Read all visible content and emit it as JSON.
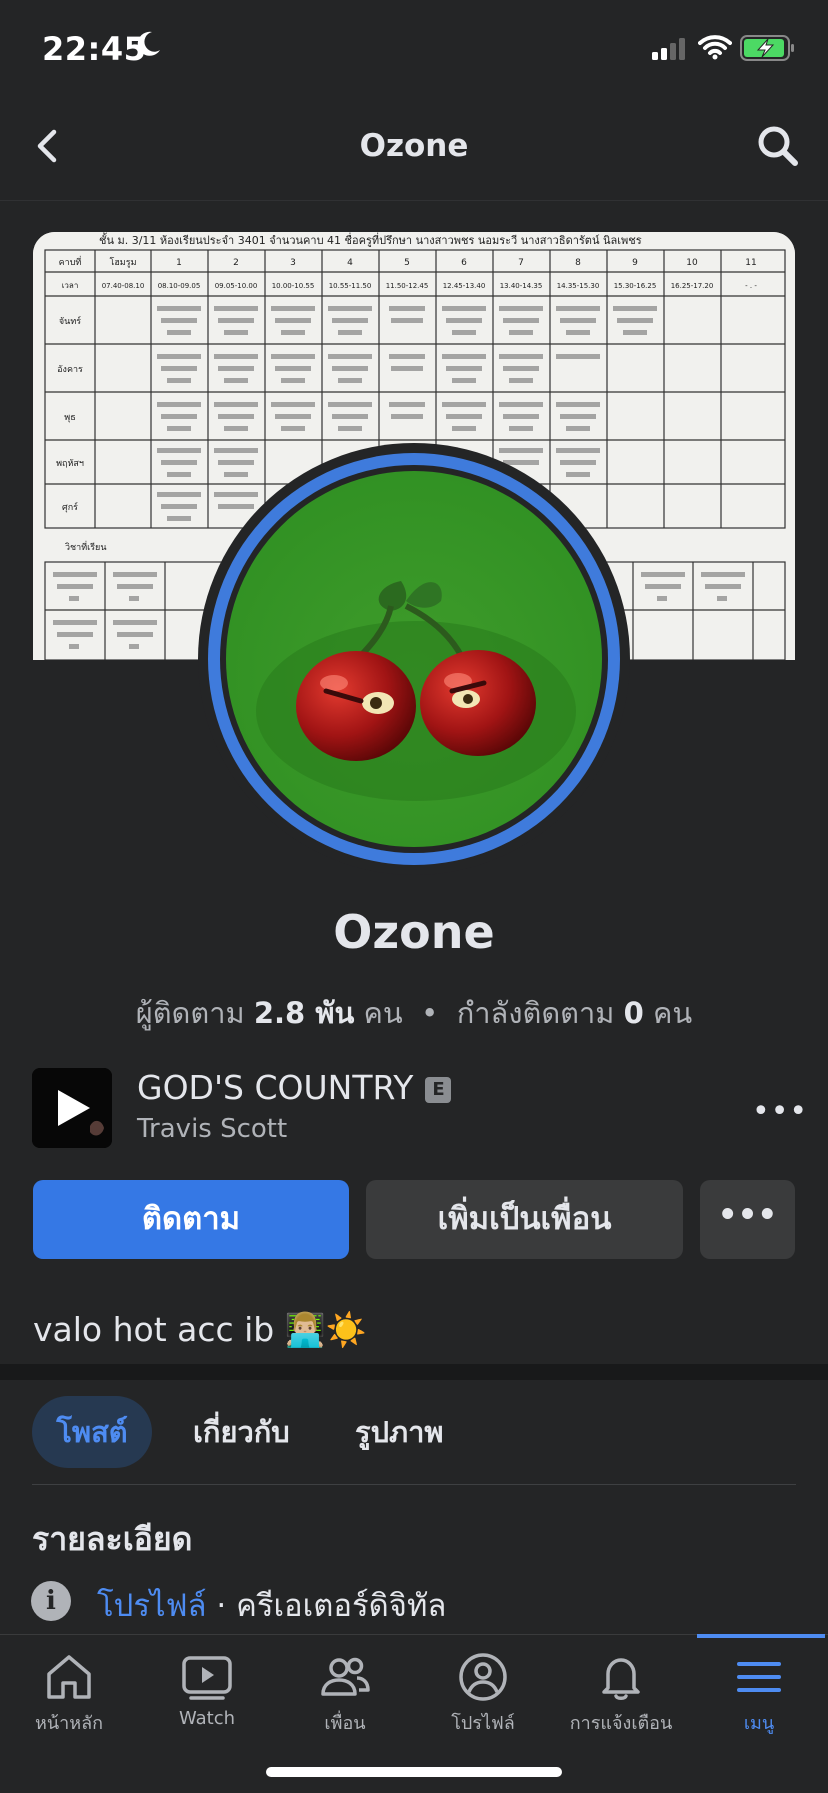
{
  "status_bar": {
    "time": "22:45"
  },
  "top_nav": {
    "title": "Ozone"
  },
  "cover": {
    "header_line": "ชั้น ม. 3/11  ห้องเรียนประจำ 3401  จำนวนคาบ 41  ชื่อครูที่ปรึกษา นางสาวพชร  นอมระวี  นางสาวธิดารัตน์  นิลเพชร",
    "columns": [
      "คาบที่",
      "โฮมรูม",
      "1",
      "2",
      "3",
      "4",
      "5",
      "6",
      "7",
      "8",
      "9",
      "10",
      "11"
    ],
    "times": [
      "เวลา",
      "07.40-08.10",
      "08.10-09.05",
      "09.05-10.00",
      "10.00-10.55",
      "10.55-11.50",
      "11.50-12.45",
      "12.45-13.40",
      "13.40-14.35",
      "14.35-15.30",
      "15.30-16.25",
      "16.25-17.20",
      "- . -"
    ],
    "days": [
      "จันทร์",
      "อังคาร",
      "พุธ",
      "พฤหัสฯ",
      "ศุกร์"
    ],
    "subjects_label": "วิชาที่เรียน"
  },
  "profile": {
    "name": "Ozone",
    "followers_label": "ผู้ติดตาม",
    "followers_value": "2.8 พัน",
    "followers_unit": "คน",
    "separator": "•",
    "following_label": "กำลังติดตาม",
    "following_value": "0",
    "following_unit": "คน"
  },
  "music": {
    "song": "GOD'S COUNTRY",
    "explicit_badge": "E",
    "artist": "Travis Scott",
    "more": "•••"
  },
  "actions": {
    "follow": "ติดตาม",
    "add_friend": "เพิ่มเป็นเพื่อน",
    "more": "•••"
  },
  "bio": "valo hot acc ib 👨🏼‍💻☀️",
  "tabs": {
    "posts": "โพสต์",
    "about": "เกี่ยวกับ",
    "photos": "รูปภาพ"
  },
  "details": {
    "heading": "รายละเอียด",
    "link": "โปรไฟล์",
    "separator": " · ",
    "category": "ครีเอเตอร์ดิจิทัล"
  },
  "tab_bar": {
    "home": "หน้าหลัก",
    "watch": "Watch",
    "friends": "เพื่อน",
    "profile": "โปรไฟล์",
    "notifications": "การแจ้งเตือน",
    "menu": "เมนู"
  },
  "colors": {
    "accent": "#3578e5",
    "link": "#4e8cf2",
    "background": "#242526",
    "avatar_ring": "#3f7bdc"
  }
}
